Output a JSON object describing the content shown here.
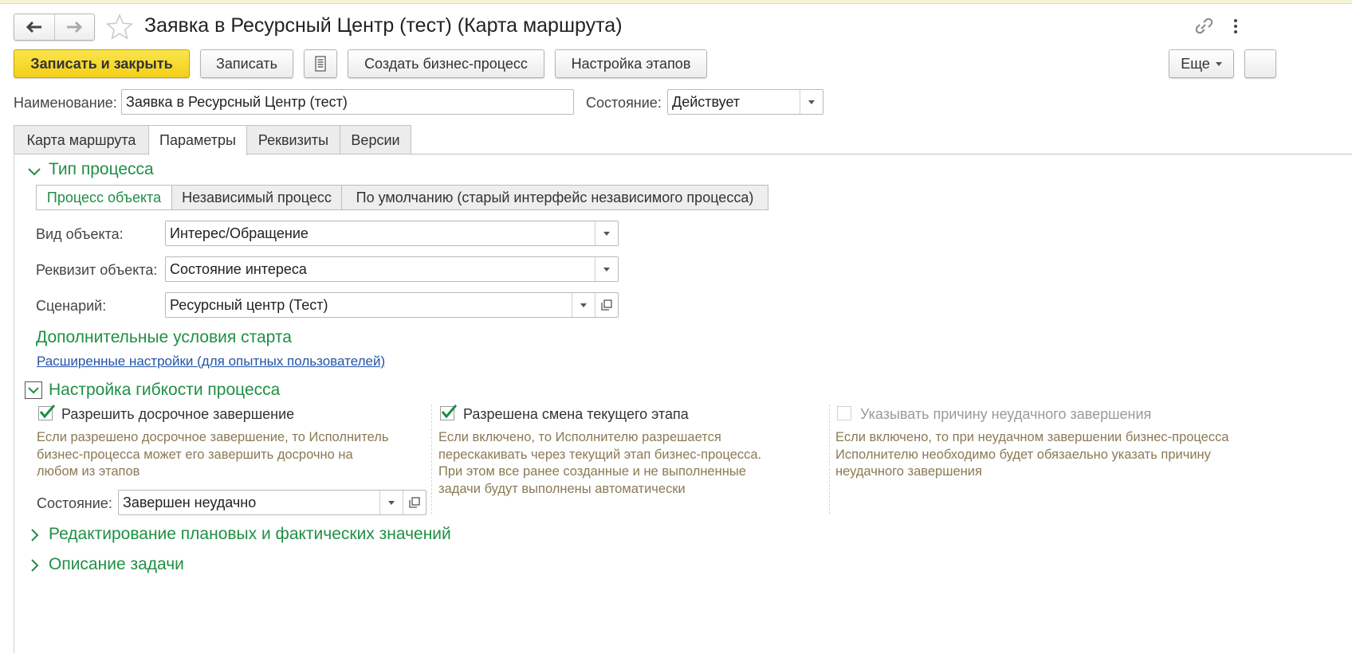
{
  "window": {
    "title": "Заявка в Ресурсный Центр (тест) (Карта маршрута)"
  },
  "toolbar": {
    "save_close_label": "Записать и закрыть",
    "save_label": "Записать",
    "create_bp_label": "Создать бизнес-процесс",
    "stage_settings_label": "Настройка этапов",
    "more_label": "Еще"
  },
  "header": {
    "name_label": "Наименование:",
    "name_value": "Заявка в Ресурсный Центр (тест)",
    "state_label": "Состояние:",
    "state_value": "Действует"
  },
  "tabs": [
    {
      "label": "Карта маршрута"
    },
    {
      "label": "Параметры"
    },
    {
      "label": "Реквизиты"
    },
    {
      "label": "Версии"
    }
  ],
  "process_type": {
    "title": "Тип процесса",
    "options": [
      {
        "label": "Процесс объекта"
      },
      {
        "label": "Независимый процесс"
      },
      {
        "label": "По умолчанию (старый интерфейс независимого  процесса)"
      }
    ],
    "selected": "Процесс объекта",
    "object_kind_label": "Вид объекта:",
    "object_kind_value": "Интерес/Обращение",
    "object_attr_label": "Реквизит объекта:",
    "object_attr_value": "Состояние интереса",
    "scenario_label": "Сценарий:",
    "scenario_value": "Ресурсный центр (Тест)",
    "extra_conditions_title": "Дополнительные условия старта",
    "advanced_link": "Расширенные настройки (для опытных пользователей)"
  },
  "flexibility": {
    "title": "Настройка гибкости процесса",
    "early_finish": {
      "label": "Разрешить досрочное завершение",
      "checked": true,
      "desc": "Если разрешено досрочное завершение, то Исполнитель\nбизнес-процесса может его завершить досрочно на\nлюбом из этапов",
      "state_label": "Состояние:",
      "state_value": "Завершен неудачно"
    },
    "stage_change": {
      "label": "Разрешена смена текущего этапа",
      "checked": true,
      "desc": "Если включено, то Исполнителю разрешается\nперескакивать через текущий этап  бизнес-процесса.\nПри этом все ранее созданные и не выполненные\nзадачи будут выполнены автоматически"
    },
    "fail_reason": {
      "label": "Указывать причину неудачного завершения",
      "checked": false,
      "desc": "Если включено, то при неудачном завершении бизнес-процесса\nИсполнителю необходимо будет обязаельно указать причину\nнеудачного завершения"
    }
  },
  "sections": {
    "plan_fact": "Редактирование плановых и фактических значений",
    "task_desc": "Описание задачи"
  },
  "colors": {
    "accent_green": "#1f8f45",
    "primary_button": "#f3cf18",
    "link_blue": "#2354a8",
    "desc_text": "#8a7a54"
  }
}
